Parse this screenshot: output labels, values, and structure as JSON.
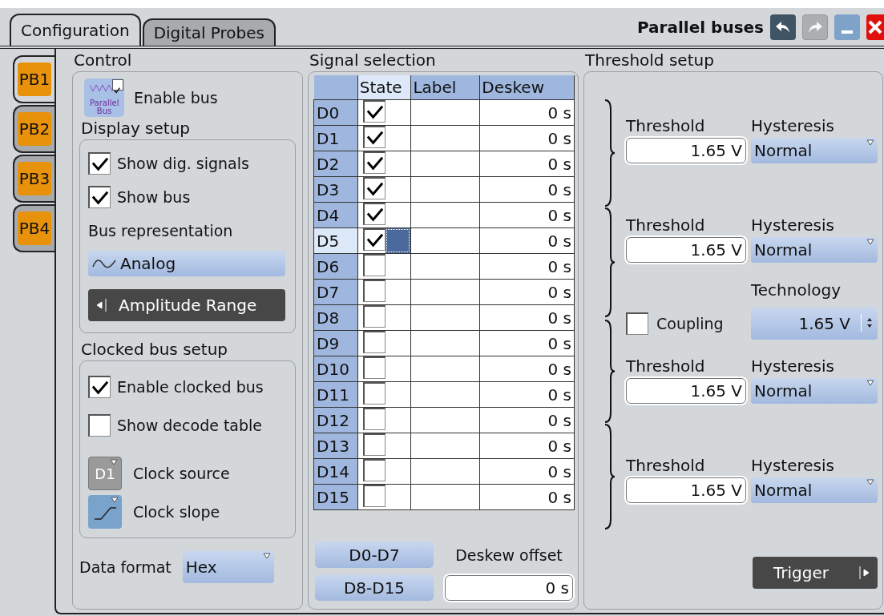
{
  "tabs": [
    {
      "label": "Configuration",
      "selected": true
    },
    {
      "label": "Digital Probes",
      "selected": false
    }
  ],
  "title": "Parallel buses",
  "title_buttons": [
    {
      "kind": "undo",
      "disabled": false
    },
    {
      "kind": "redo",
      "disabled": true
    },
    {
      "kind": "minimize",
      "disabled": false
    },
    {
      "kind": "close",
      "disabled": false
    }
  ],
  "bus_tabs": [
    {
      "label": "PB1",
      "selected": true
    },
    {
      "label": "PB2",
      "selected": false
    },
    {
      "label": "PB3",
      "selected": false
    },
    {
      "label": "PB4",
      "selected": false
    }
  ],
  "control": {
    "heading": "Control",
    "enable_bus": {
      "icon_text": "Parallel Bus",
      "label": "Enable bus",
      "checked": true
    },
    "display_setup": {
      "heading": "Display setup",
      "checkboxes": [
        {
          "label": "Show dig. signals",
          "checked": true
        },
        {
          "label": "Show bus",
          "checked": true
        }
      ],
      "bus_representation": {
        "label": "Bus representation",
        "value": "Analog"
      },
      "amplitude_button": "Amplitude Range"
    },
    "clocked_bus_setup": {
      "heading": "Clocked bus setup",
      "checkboxes": [
        {
          "label": "Enable clocked bus",
          "checked": true
        },
        {
          "label": "Show decode table",
          "checked": false
        }
      ],
      "clock_source": {
        "value": "D1",
        "label": "Clock source"
      },
      "clock_slope": {
        "label": "Clock slope"
      }
    },
    "data_format": {
      "label": "Data format",
      "value": "Hex"
    }
  },
  "signal_selection": {
    "heading": "Signal selection",
    "columns": [
      {
        "label": "State",
        "selected": true
      },
      {
        "label": "Label",
        "selected": false
      },
      {
        "label": "Deskew",
        "selected": false
      }
    ],
    "rows": [
      {
        "name": "D0",
        "checked": true,
        "deskew": "0 s",
        "selected": false
      },
      {
        "name": "D1",
        "checked": true,
        "deskew": "0 s",
        "selected": false
      },
      {
        "name": "D2",
        "checked": true,
        "deskew": "0 s",
        "selected": false
      },
      {
        "name": "D3",
        "checked": true,
        "deskew": "0 s",
        "selected": false
      },
      {
        "name": "D4",
        "checked": true,
        "deskew": "0 s",
        "selected": false
      },
      {
        "name": "D5",
        "checked": true,
        "deskew": "0 s",
        "selected": true
      },
      {
        "name": "D6",
        "checked": false,
        "deskew": "0 s",
        "selected": false
      },
      {
        "name": "D7",
        "checked": false,
        "deskew": "0 s",
        "selected": false
      },
      {
        "name": "D8",
        "checked": false,
        "deskew": "0 s",
        "selected": false
      },
      {
        "name": "D9",
        "checked": false,
        "deskew": "0 s",
        "selected": false
      },
      {
        "name": "D10",
        "checked": false,
        "deskew": "0 s",
        "selected": false
      },
      {
        "name": "D11",
        "checked": false,
        "deskew": "0 s",
        "selected": false
      },
      {
        "name": "D12",
        "checked": false,
        "deskew": "0 s",
        "selected": false
      },
      {
        "name": "D13",
        "checked": false,
        "deskew": "0 s",
        "selected": false
      },
      {
        "name": "D14",
        "checked": false,
        "deskew": "0 s",
        "selected": false
      },
      {
        "name": "D15",
        "checked": false,
        "deskew": "0 s",
        "selected": false
      }
    ],
    "buttons": [
      "D0-D7",
      "D8-D15"
    ],
    "deskew_offset": {
      "label": "Deskew offset",
      "value": "0 s"
    }
  },
  "threshold_setup": {
    "heading": "Threshold setup",
    "groups": [
      {
        "threshold_label": "Threshold",
        "threshold": "1.65 V",
        "hysteresis_label": "Hysteresis",
        "hysteresis": "Normal"
      },
      {
        "threshold_label": "Threshold",
        "threshold": "1.65 V",
        "hysteresis_label": "Hysteresis",
        "hysteresis": "Normal"
      },
      {
        "threshold_label": "Threshold",
        "threshold": "1.65 V",
        "hysteresis_label": "Hysteresis",
        "hysteresis": "Normal"
      },
      {
        "threshold_label": "Threshold",
        "threshold": "1.65 V",
        "hysteresis_label": "Hysteresis",
        "hysteresis": "Normal"
      }
    ],
    "coupling": {
      "label": "Coupling",
      "checked": false
    },
    "technology": {
      "label": "Technology",
      "value": "1.65 V"
    },
    "trigger_button": "Trigger"
  }
}
